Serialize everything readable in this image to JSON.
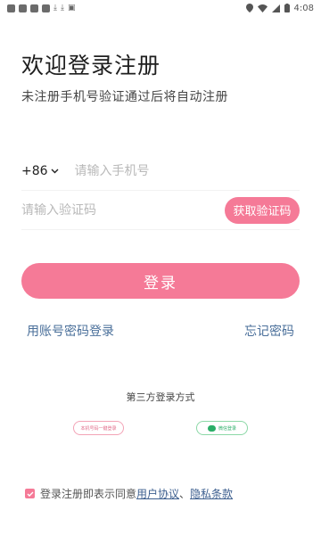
{
  "status_bar": {
    "time": "4:08"
  },
  "header": {
    "title": "欢迎登录注册",
    "subtitle": "未注册手机号验证通过后将自动注册"
  },
  "form": {
    "country_code": "+86",
    "phone_placeholder": "请输入手机号",
    "code_placeholder": "请输入验证码",
    "get_code_label": "获取验证码",
    "login_label": "登录"
  },
  "links": {
    "account_login": "用账号密码登录",
    "forgot_password": "忘记密码"
  },
  "third_party": {
    "title": "第三方登录方式",
    "onekey_label": "本机号码一键登录",
    "wechat_label": "微信登录"
  },
  "agreement": {
    "checked": true,
    "prefix": "登录注册即表示同意",
    "user_agreement": "用户协议",
    "separator": "、",
    "privacy": "隐私条款"
  },
  "colors": {
    "accent": "#f57a97",
    "link": "#4a6f9a",
    "wechat": "#2aae67"
  }
}
